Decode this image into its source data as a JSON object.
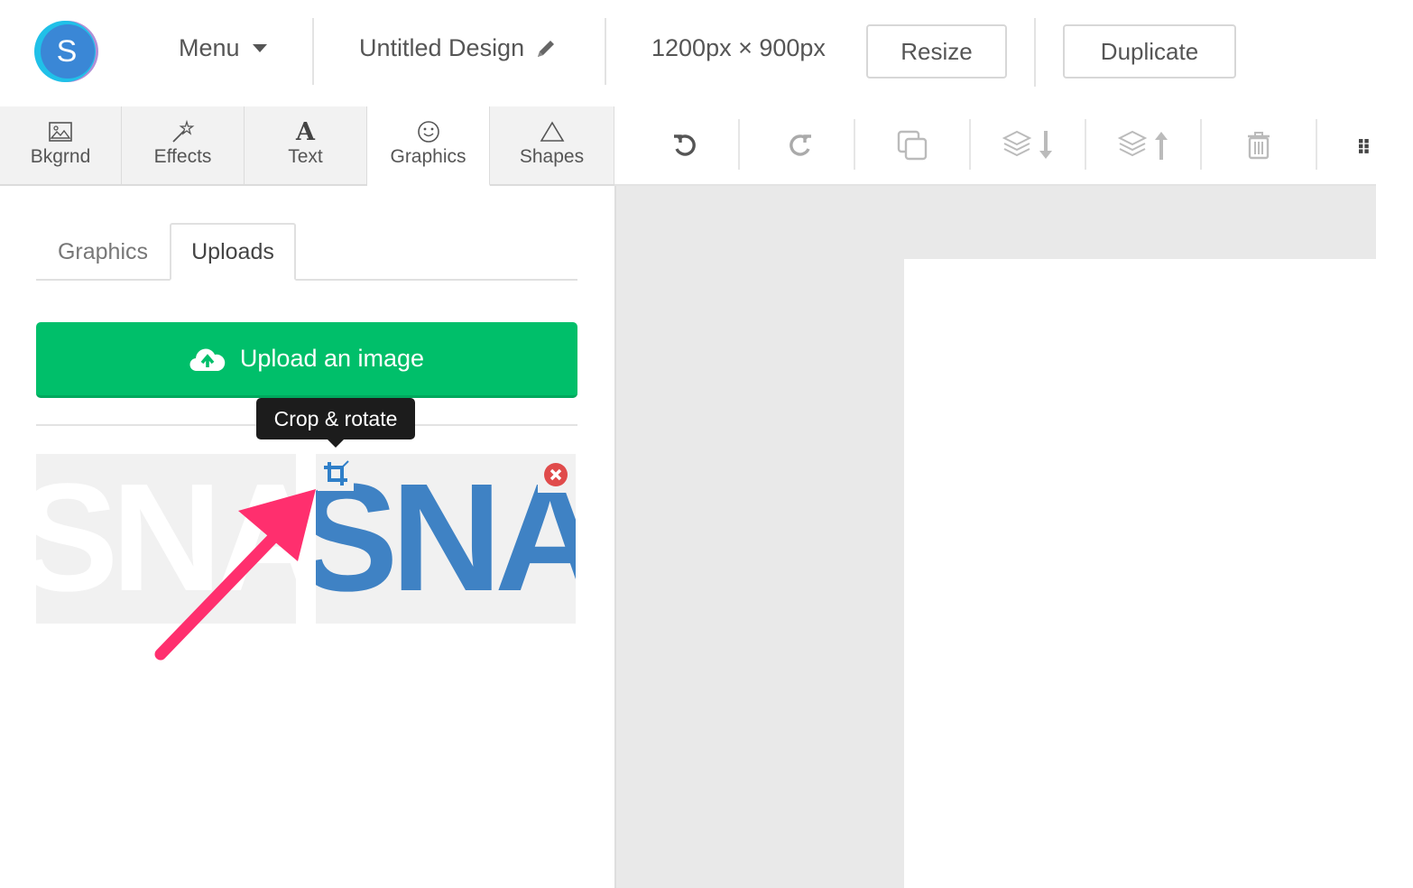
{
  "header": {
    "logo_letter": "S",
    "menu_label": "Menu",
    "design_title": "Untitled Design",
    "dimensions": "1200px × 900px",
    "resize_label": "Resize",
    "duplicate_label": "Duplicate"
  },
  "tool_tabs": [
    {
      "label": "Bkgrnd",
      "icon": "image-icon"
    },
    {
      "label": "Effects",
      "icon": "magic-wand-icon"
    },
    {
      "label": "Text",
      "icon": "text-icon",
      "glyph": "A"
    },
    {
      "label": "Graphics",
      "icon": "smiley-icon",
      "active": true
    },
    {
      "label": "Shapes",
      "icon": "triangle-icon"
    }
  ],
  "toolbar": {
    "icons": [
      "undo-icon",
      "redo-icon",
      "copy-icon",
      "send-backward-icon",
      "bring-forward-icon",
      "trash-icon",
      "grid-icon"
    ]
  },
  "sidebar": {
    "subtabs": [
      {
        "label": "Graphics",
        "active": false
      },
      {
        "label": "Uploads",
        "active": true
      }
    ],
    "upload_label": "Upload an image",
    "tooltip": "Crop & rotate",
    "thumbnails": [
      {
        "text": "SNA",
        "text_color": "#ffffff"
      },
      {
        "text": "SNA",
        "text_color": "#3f82c4"
      }
    ]
  },
  "colors": {
    "upload_green": "#00bf6a",
    "logo_blue": "#3a87d6",
    "delete_red": "#e04b4b",
    "annotation_arrow": "#ff2f6e"
  }
}
